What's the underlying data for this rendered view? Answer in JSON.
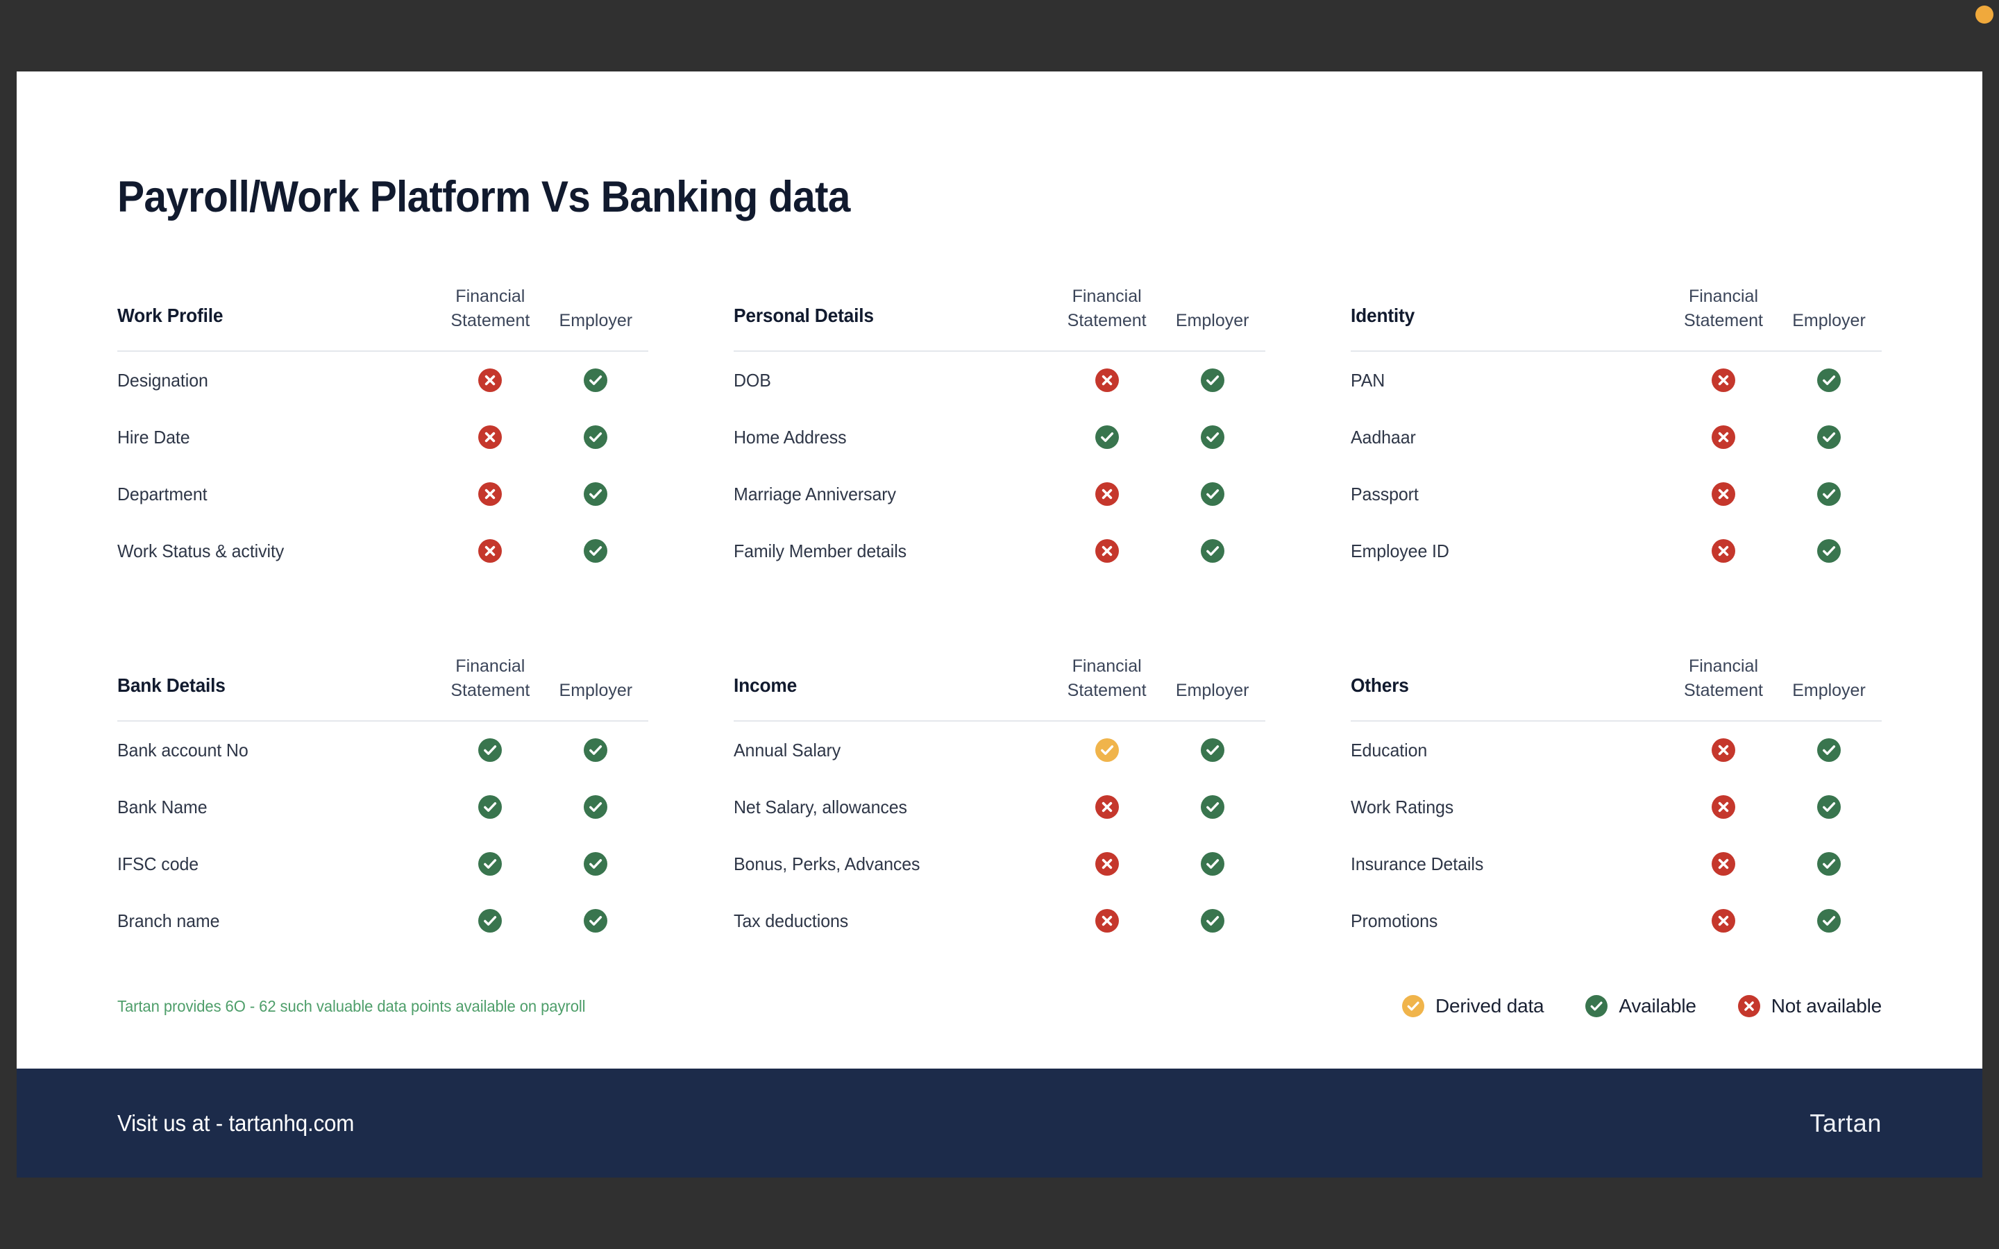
{
  "page_title": "Payroll/Work Platform Vs Banking data",
  "column_headers": {
    "financial_statement": "Financial\nStatement",
    "financial_statement_line1": "Financial",
    "financial_statement_line2": "Statement",
    "employer": "Employer"
  },
  "tables": [
    {
      "title": "Work Profile",
      "rows": [
        {
          "label": "Designation",
          "financial_statement": "no",
          "employer": "yes"
        },
        {
          "label": "Hire Date",
          "financial_statement": "no",
          "employer": "yes"
        },
        {
          "label": "Department",
          "financial_statement": "no",
          "employer": "yes"
        },
        {
          "label": "Work Status & activity",
          "financial_statement": "no",
          "employer": "yes"
        }
      ]
    },
    {
      "title": "Personal Details",
      "rows": [
        {
          "label": "DOB",
          "financial_statement": "no",
          "employer": "yes"
        },
        {
          "label": "Home Address",
          "financial_statement": "yes",
          "employer": "yes"
        },
        {
          "label": "Marriage Anniversary",
          "financial_statement": "no",
          "employer": "yes"
        },
        {
          "label": "Family Member details",
          "financial_statement": "no",
          "employer": "yes"
        }
      ]
    },
    {
      "title": "Identity",
      "rows": [
        {
          "label": "PAN",
          "financial_statement": "no",
          "employer": "yes"
        },
        {
          "label": "Aadhaar",
          "financial_statement": "no",
          "employer": "yes"
        },
        {
          "label": "Passport",
          "financial_statement": "no",
          "employer": "yes"
        },
        {
          "label": "Employee ID",
          "financial_statement": "no",
          "employer": "yes"
        }
      ]
    },
    {
      "title": "Bank Details",
      "rows": [
        {
          "label": "Bank account No",
          "financial_statement": "yes",
          "employer": "yes"
        },
        {
          "label": "Bank Name",
          "financial_statement": "yes",
          "employer": "yes"
        },
        {
          "label": "IFSC code",
          "financial_statement": "yes",
          "employer": "yes"
        },
        {
          "label": "Branch name",
          "financial_statement": "yes",
          "employer": "yes"
        }
      ]
    },
    {
      "title": "Income",
      "rows": [
        {
          "label": "Annual Salary",
          "financial_statement": "derived",
          "employer": "yes"
        },
        {
          "label": "Net Salary, allowances",
          "financial_statement": "no",
          "employer": "yes"
        },
        {
          "label": "Bonus, Perks, Advances",
          "financial_statement": "no",
          "employer": "yes"
        },
        {
          "label": "Tax deductions",
          "financial_statement": "no",
          "employer": "yes"
        }
      ]
    },
    {
      "title": "Others",
      "rows": [
        {
          "label": "Education",
          "financial_statement": "no",
          "employer": "yes"
        },
        {
          "label": "Work Ratings",
          "financial_statement": "no",
          "employer": "yes"
        },
        {
          "label": "Insurance Details",
          "financial_statement": "no",
          "employer": "yes"
        },
        {
          "label": "Promotions",
          "financial_statement": "no",
          "employer": "yes"
        }
      ]
    }
  ],
  "footnote": "Tartan provides 6O - 62 such valuable data points available on payroll",
  "legend": [
    {
      "status": "derived",
      "label": "Derived data"
    },
    {
      "status": "yes",
      "label": "Available"
    },
    {
      "status": "no",
      "label": "Not available"
    }
  ],
  "footer": {
    "visit_text": "Visit us at - tartanhq.com",
    "logo": "Tartan"
  },
  "colors": {
    "backdrop": "#303030",
    "slide_background": "#FFFFFF",
    "title": "#111A2E",
    "available_green": "#39754E",
    "not_available_red": "#C5372C",
    "derived_amber": "#F0B44B",
    "footnote_green": "#4E9E6A",
    "footer_navy": "#1C2B4A",
    "divider": "#E4E7EC",
    "cursor_dot": "#F0A93C"
  },
  "icons": {
    "check": "check-circle-icon",
    "cross": "x-circle-icon",
    "cursor_dot": "cursor-dot-icon"
  }
}
